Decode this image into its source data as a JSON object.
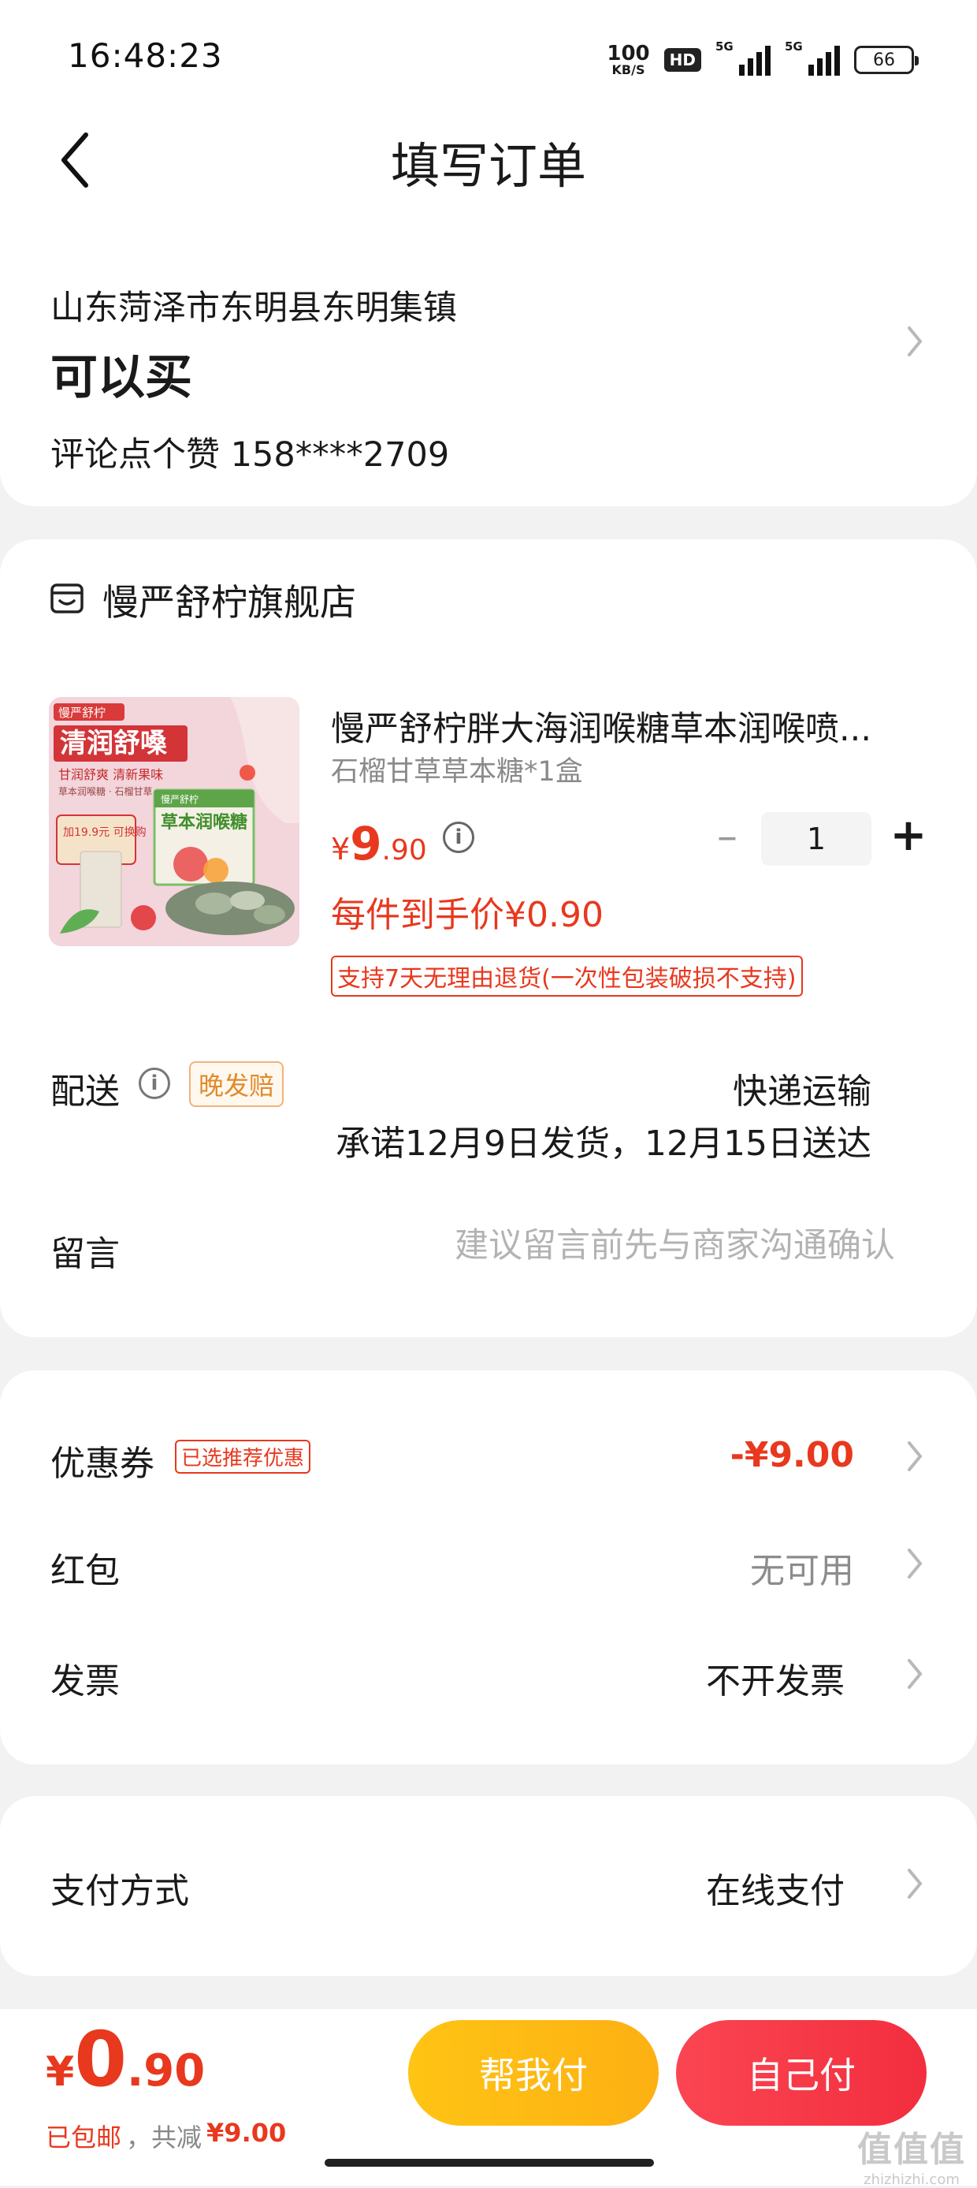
{
  "status_bar": {
    "time": "16:48:23",
    "net_speed": "100",
    "net_unit": "KB/S",
    "hd_label": "HD",
    "sim1": "5G",
    "sim2": "5G",
    "battery": "66"
  },
  "header": {
    "title": "填写订单",
    "back_icon": "chevron-left-icon"
  },
  "address": {
    "region": "山东菏泽市东明县东明集镇",
    "detail": "可以买",
    "contact": "评论点个赞  158****2709"
  },
  "shop": {
    "store_icon": "store-icon",
    "store_name": "慢严舒柠旗舰店",
    "product": {
      "title": "慢严舒柠胖大海润喉糖草本润喉喷...",
      "spec": "石榴甘草草本糖*1盒",
      "price_symbol": "¥",
      "price_int": "9",
      "price_dec": ".90",
      "quantity": "1",
      "unit_price_label": "每件到手价¥0.90",
      "return_policy": "支持7天无理由退货(一次性包装破损不支持)",
      "image_text": {
        "brand": "慢严舒柠",
        "headline": "清润舒嗓",
        "tagline": "甘润舒爽 清新果味",
        "sub": "草本润喉糖 · 石榴甘草",
        "box_brand": "慢严舒柠",
        "box_name": "草本润喉糖",
        "promo": "加19.9元 可换购"
      }
    },
    "delivery": {
      "label": "配送",
      "badge": "晚发赔",
      "method": "快递运输",
      "schedule": "承诺12月9日发货，12月15日送达"
    },
    "message": {
      "label": "留言",
      "placeholder": "建议留言前先与商家沟通确认"
    }
  },
  "discounts": {
    "coupon": {
      "label": "优惠券",
      "badge": "已选推荐优惠",
      "value": "-¥9.00"
    },
    "red_packet": {
      "label": "红包",
      "value": "无可用"
    },
    "invoice": {
      "label": "发票",
      "value": "不开发票"
    }
  },
  "payment": {
    "label": "支付方式",
    "value": "在线支付"
  },
  "footer": {
    "total_symbol": "¥",
    "total_int": "0",
    "total_dec": ".90",
    "shipping": "已包邮",
    "saved_label": "，共减",
    "saved_value": "¥9.00",
    "help_pay": "帮我付",
    "self_pay": "自己付",
    "watermark": "值值值",
    "watermark_url": "zhizhizhi.com"
  },
  "colors": {
    "accent_red": "#e8381e",
    "help_btn": "#ffc414",
    "self_btn": "#f22e3e"
  }
}
